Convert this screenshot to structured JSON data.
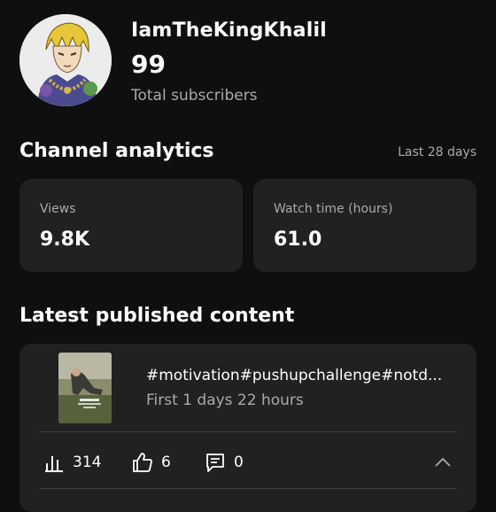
{
  "channel": {
    "name": "IamTheKingKhalil",
    "subscriber_count": "99",
    "subscriber_label": "Total subscribers"
  },
  "analytics": {
    "title": "Channel analytics",
    "range": "Last 28 days",
    "cards": [
      {
        "label": "Views",
        "value": "9.8K"
      },
      {
        "label": "Watch time (hours)",
        "value": "61.0"
      }
    ]
  },
  "latest": {
    "title": "Latest published content",
    "video": {
      "title": "#motivation#pushupchallenge#notd...",
      "age": "First 1 days 22 hours",
      "views": "314",
      "likes": "6",
      "comments": "0"
    }
  },
  "colors": {
    "background": "#0f0f0f",
    "card": "#212121",
    "text_primary": "#ffffff",
    "text_secondary": "#aaaaaa",
    "divider": "#3f3f3f"
  },
  "icons": [
    "analytics-bars-icon",
    "thumbs-up-icon",
    "comment-icon",
    "chevron-up-icon"
  ]
}
